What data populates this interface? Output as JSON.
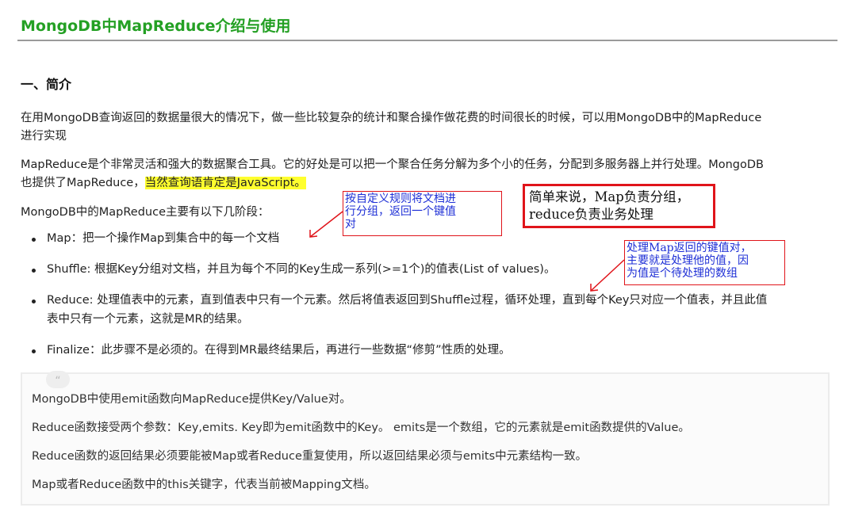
{
  "title": "MongoDB中MapReduce介绍与使用",
  "section_heading": "一、简介",
  "paragraphs": {
    "p1_line1": "在用MongoDB查询返回的数据量很大的情况下，做一些比较复杂的统计和聚合操作做花费的时间很长的时候，可以用MongoDB中的MapReduce",
    "p1_line2": "进行实现",
    "p2_line1": "MapReduce是个非常灵活和强大的数据聚合工具。它的好处是可以把一个聚合任务分解为多个小的任务，分配到多服务器上并行处理。MongoDB",
    "p2_line2_plain": "也提供了MapReduce，",
    "p2_line2_highlight": "当然查询语肯定是JavaScript。",
    "p3": "MongoDB中的MapReduce主要有以下几阶段："
  },
  "bullets": {
    "map": "Map：把一个操作Map到集合中的每一个文档",
    "shuffle": "Shuffle: 根据Key分组对文档，并且为每个不同的Key生成一系列(>=1个)的值表(List of values)。",
    "reduce_line1": "Reduce: 处理值表中的元素，直到值表中只有一个元素。然后将值表返回到Shuffle过程，循环处理，直到每个Key只对应一个值表，并且此值",
    "reduce_line2": "表中只有一个元素，这就是MR的结果。",
    "finalize": "Finalize：此步骤不是必须的。在得到MR最终结果后，再进行一些数据“修剪”性质的处理。"
  },
  "quote": {
    "mark": "“",
    "lines": [
      "MongoDB中使用emit函数向MapReduce提供Key/Value对。",
      "Reduce函数接受两个参数：Key,emits. Key即为emit函数中的Key。 emits是一个数组，它的元素就是emit函数提供的Value。",
      "Reduce函数的返回结果必须要能被Map或者Reduce重复使用，所以返回结果必须与emits中元素结构一致。",
      "Map或者Reduce函数中的this关键字，代表当前被Mapping文档。"
    ]
  },
  "annotations": {
    "map_note": [
      "按自定义规则将文档进",
      "行分组，返回一个键值",
      "对"
    ],
    "summary_note": [
      "简单来说，Map负责分组，",
      "reduce负责业务处理"
    ],
    "reduce_note": [
      "处理Map返回的键值对，",
      "主要就是处理他的值，因",
      "为值是个待处理的数组"
    ]
  },
  "colors": {
    "title": "#24a024",
    "annotation_border": "#e0141a",
    "annotation_blue_text": "#1e2fd6",
    "highlight": "#ffff2e"
  }
}
